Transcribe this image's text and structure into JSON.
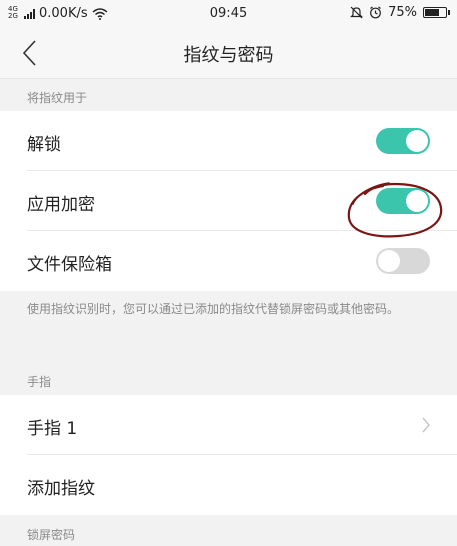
{
  "status_bar": {
    "network_type": "4G",
    "network_type2": "2G",
    "speed": "0.00K/s",
    "time": "09:45",
    "battery_percent": "75%",
    "battery_level": 0.75
  },
  "header": {
    "title": "指纹与密码"
  },
  "sections": {
    "fingerprint_use_label": "将指纹用于",
    "fingers_label": "手指",
    "lock_password_label": "锁屏密码"
  },
  "settings": {
    "unlock": {
      "label": "解锁",
      "enabled": true
    },
    "app_encryption": {
      "label": "应用加密",
      "enabled": true
    },
    "file_vault": {
      "label": "文件保险箱",
      "enabled": false
    }
  },
  "note": "使用指纹识别时，您可以通过已添加的指纹代替锁屏密码或其他密码。",
  "fingers": {
    "finger1_label": "手指 1",
    "add_label": "添加指纹"
  },
  "colors": {
    "toggle_on": "#3cc5ad",
    "toggle_off": "#d8d8d8",
    "annotation": "#7a1616"
  }
}
